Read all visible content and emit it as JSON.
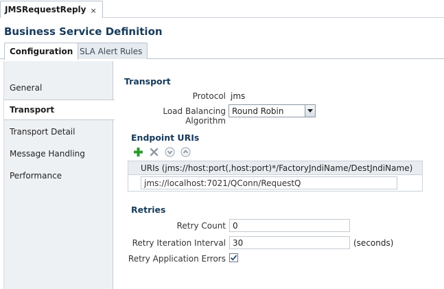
{
  "doc_tab": {
    "label": "JMSRequestReply",
    "close": "×"
  },
  "page": {
    "title": "Business Service Definition"
  },
  "subtabs": [
    {
      "label": "Configuration"
    },
    {
      "label": "SLA Alert Rules"
    }
  ],
  "nav": {
    "items": [
      {
        "label": "General"
      },
      {
        "label": "Transport"
      },
      {
        "label": "Transport Detail"
      },
      {
        "label": "Message Handling"
      },
      {
        "label": "Performance"
      }
    ]
  },
  "transport": {
    "title": "Transport",
    "protocol_label": "Protocol",
    "protocol_value": "jms",
    "lb_label": "Load Balancing Algorithm",
    "lb_value": "Round Robin"
  },
  "endpoints": {
    "title": "Endpoint URIs",
    "column_header": "URIs (jms://host:port(,host:port)*/FactoryJndiName/DestJndiName)",
    "uris": [
      "jms://localhost:7021/QConn/RequestQ"
    ]
  },
  "retries": {
    "title": "Retries",
    "count_label": "Retry Count",
    "count_value": "0",
    "interval_label": "Retry Iteration Interval",
    "interval_value": "30",
    "interval_unit": "(seconds)",
    "app_errors_label": "Retry Application Errors",
    "app_errors_checked": true
  },
  "icons": {
    "add": "add-icon",
    "delete": "delete-icon",
    "move_down": "move-down-icon",
    "move_up": "move-up-icon",
    "colors": {
      "add": "#2e9a2e",
      "disabled": "#9aa4ae"
    }
  }
}
